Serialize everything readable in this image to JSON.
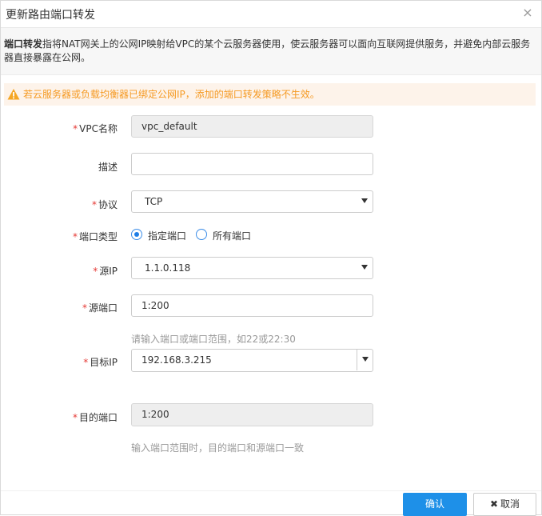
{
  "dialog": {
    "title": "更新路由端口转发",
    "close_glyph": "×"
  },
  "info": {
    "term": "端口转发",
    "text": "指将NAT网关上的公网IP映射给VPC的某个云服务器使用，使云服务器可以面向互联网提供服务，并避免内部云服务器直接暴露在公网。"
  },
  "warning": {
    "text": "若云服务器或负载均衡器已绑定公网IP，添加的端口转发策略不生效。",
    "color": "#f59a23"
  },
  "form": {
    "required_mark": "*",
    "vpc": {
      "label": "VPC名称",
      "value": "vpc_default"
    },
    "desc": {
      "label": "描述",
      "value": ""
    },
    "protocol": {
      "label": "协议",
      "value": "TCP"
    },
    "port_type": {
      "label": "端口类型",
      "option1": "指定端口",
      "option2": "所有端口",
      "selected": "指定端口"
    },
    "source_ip": {
      "label": "源IP",
      "value": "1.1.0.118"
    },
    "source_port": {
      "label": "源端口",
      "value": "1:200",
      "hint": "请输入端口或端口范围，如22或22:30"
    },
    "target_ip": {
      "label": "目标IP",
      "value": "192.168.3.215"
    },
    "target_port": {
      "label": "目的端口",
      "value": "1:200",
      "hint": "输入端口范围时，目的端口和源端口一致"
    }
  },
  "footer": {
    "confirm_label": "确认",
    "cancel_label": "取消",
    "cancel_glyph": "✖",
    "primary_color": "#1e90e8"
  }
}
